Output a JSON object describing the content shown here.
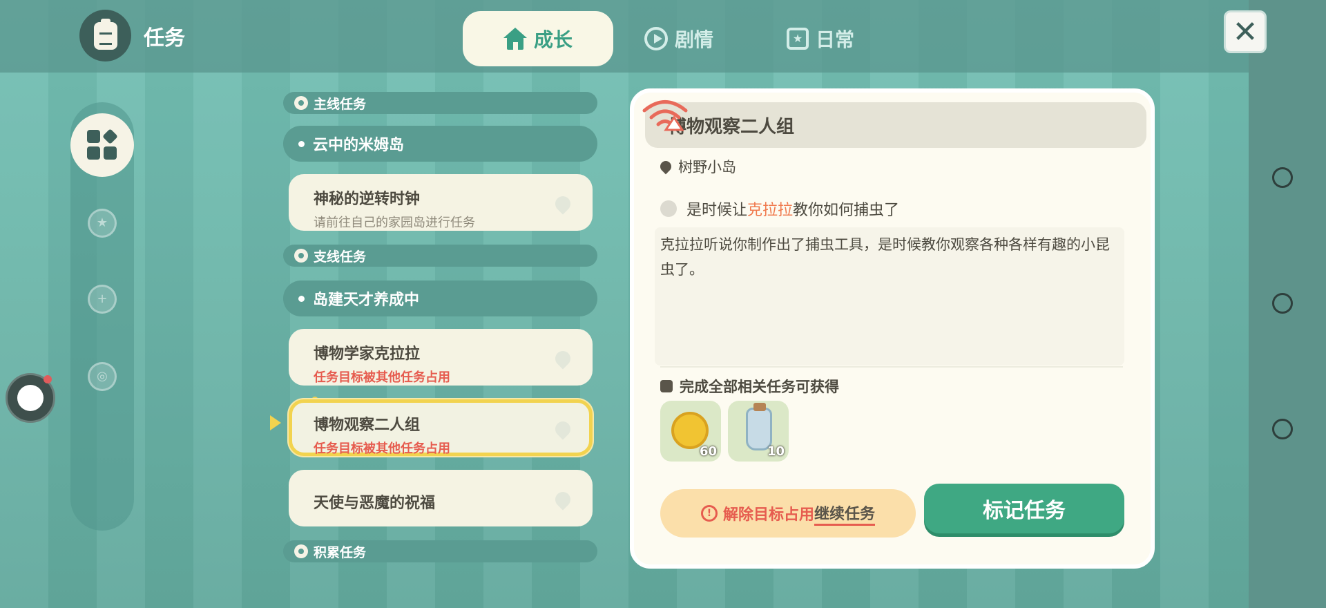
{
  "header": {
    "title": "任务",
    "icon": "clipboard-icon",
    "close_icon": "close-icon"
  },
  "tabs": [
    {
      "label": "成长",
      "icon": "house-icon",
      "active": true
    },
    {
      "label": "剧情",
      "icon": "play-circle-icon",
      "active": false
    },
    {
      "label": "日常",
      "icon": "calendar-star-icon",
      "active": false
    }
  ],
  "sidebar": {
    "items": [
      {
        "icon": "grid-icon",
        "active": true
      },
      {
        "icon": "star-badge-icon",
        "active": false
      },
      {
        "icon": "plus-badge-icon",
        "active": false
      },
      {
        "icon": "target-badge-icon",
        "active": false
      }
    ]
  },
  "task_list": {
    "main_header": "主线任务",
    "main_group": "云中的米姆岛",
    "side_header": "支线任务",
    "side_group": "岛建天才养成中",
    "accum_header": "积累任务",
    "tasks": [
      {
        "name": "神秘的逆转时钟",
        "sub": "请前往自己的家园岛进行任务"
      },
      {
        "name": "博物学家克拉拉",
        "sub": "任务目标被其他任务占用"
      },
      {
        "name": "博物观察二人组",
        "sub": "任务目标被其他任务占用"
      },
      {
        "name": "天使与恶魔的祝福",
        "sub": ""
      }
    ]
  },
  "detail": {
    "title": "博物观察二人组",
    "location": "树野小岛",
    "objective_pre": "是时候让",
    "objective_hl": "克拉拉",
    "objective_post": "教你如何捕虫了",
    "description": "克拉拉听说你制作出了捕虫工具，是时候教你观察各种各样有趣的小昆虫了。",
    "reward_title": "完成全部相关任务可获得",
    "rewards": [
      {
        "icon": "gold-coin-icon",
        "qty": "60"
      },
      {
        "icon": "bottle-icon",
        "qty": "10"
      }
    ],
    "release_label": "解除目标占用",
    "continue_label": "继续任务",
    "mark_label": "标记任务"
  },
  "colors": {
    "accent": "#3fa883",
    "warning": "#e65c4f",
    "highlight": "#f0794d",
    "selection": "#f2d34f"
  }
}
